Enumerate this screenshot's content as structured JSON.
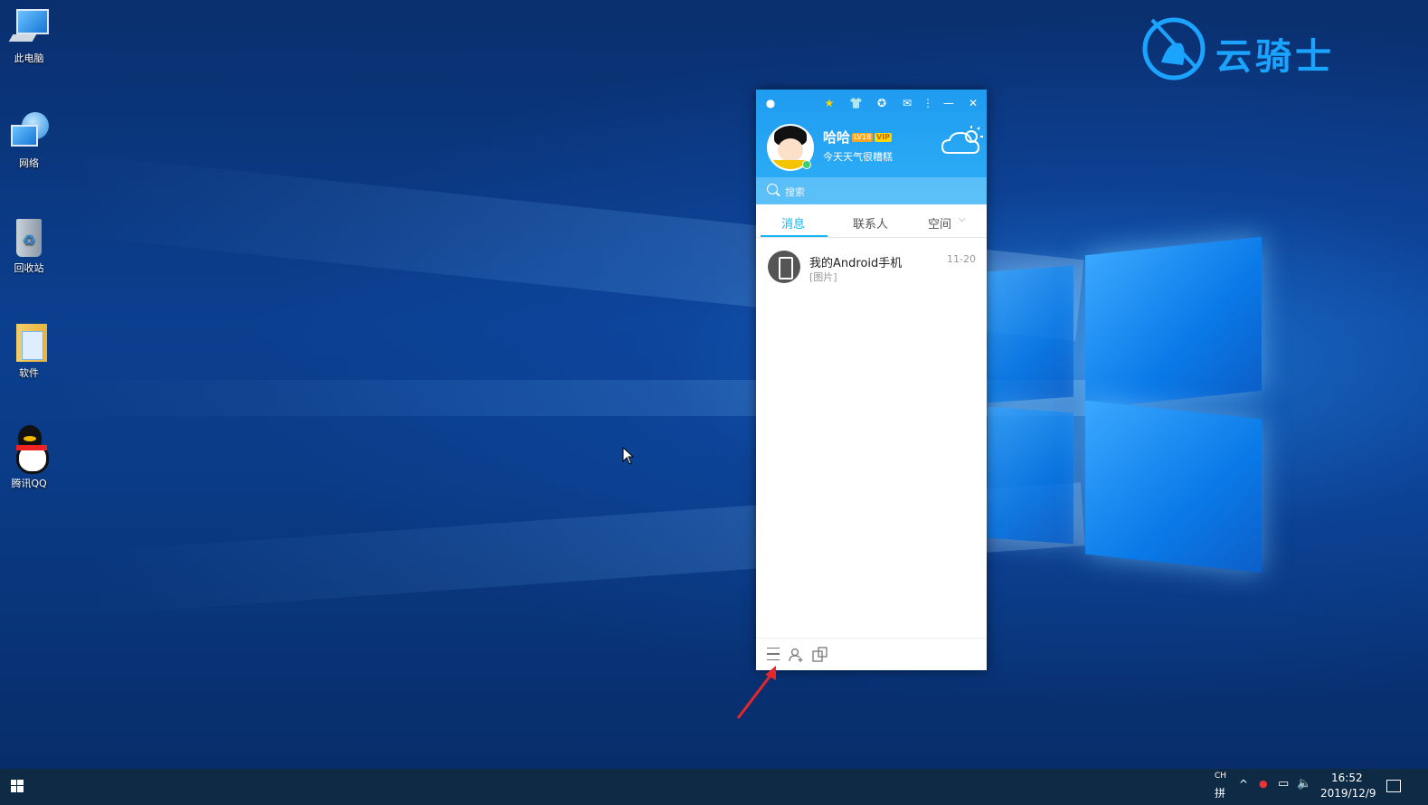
{
  "desktop": {
    "icons": [
      {
        "label": "此电脑",
        "icon": "computer-icon"
      },
      {
        "label": "网络",
        "icon": "network-icon"
      },
      {
        "label": "回收站",
        "icon": "recycle-bin-icon"
      },
      {
        "label": "软件",
        "icon": "folder-icon"
      },
      {
        "label": "腾讯QQ",
        "icon": "qq-penguin-icon"
      }
    ],
    "watermark": "云骑士"
  },
  "qq": {
    "nickname": "哈哈",
    "level_badge": "LV18",
    "vip_badge": "VIP",
    "signature": "今天天气很糟糕",
    "search_placeholder": "搜索",
    "tabs": [
      {
        "label": "消息",
        "active": true
      },
      {
        "label": "联系人",
        "active": false
      },
      {
        "label": "空间",
        "active": false
      }
    ],
    "messages": [
      {
        "name": "我的Android手机",
        "preview": "[图片]",
        "time": "11-20"
      }
    ],
    "accent_color": "#12b7f5"
  },
  "taskbar": {
    "ime_top": "CH",
    "ime_bottom": "拼",
    "time": "16:52",
    "date": "2019/12/9"
  }
}
